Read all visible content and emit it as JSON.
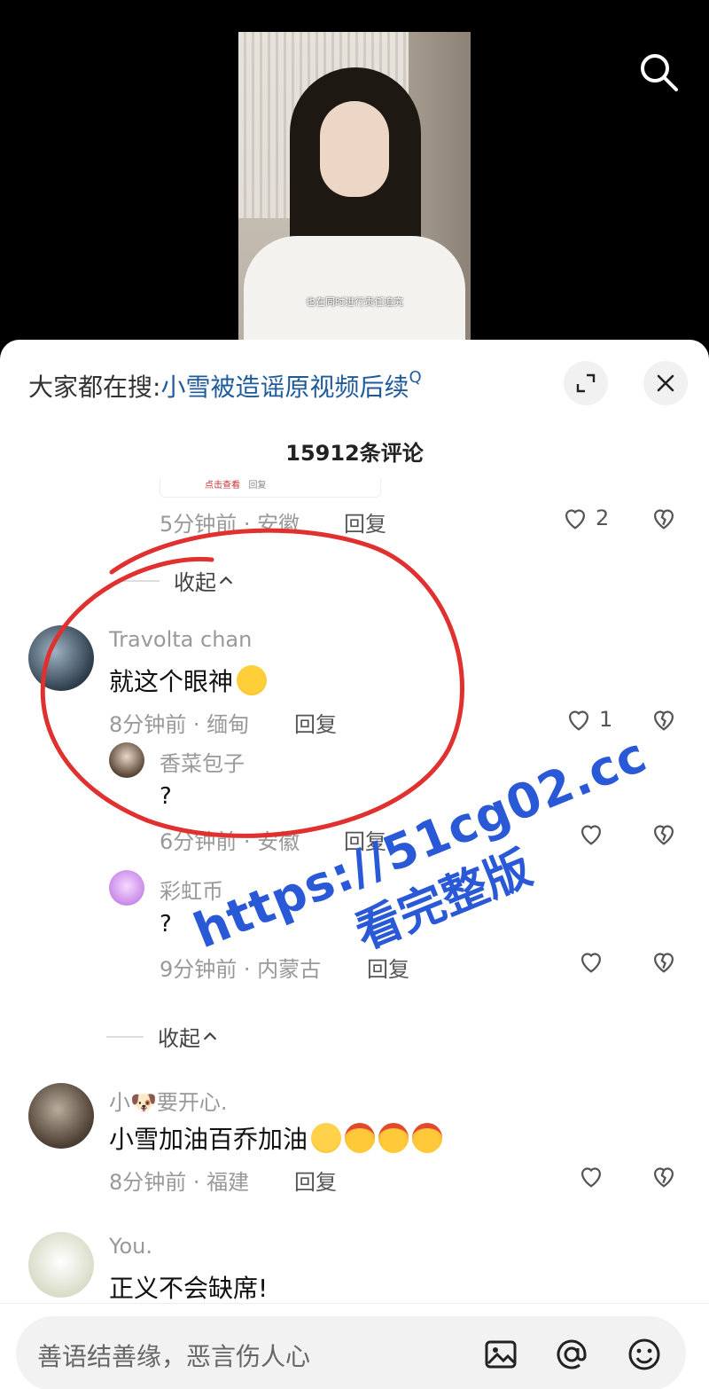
{
  "video": {
    "subtitle": "也在同时进行责任追究"
  },
  "trending": {
    "prefix": "大家都在搜:",
    "query": "小雪被造谣原视频后续",
    "search_mark": "Q"
  },
  "comments_header": {
    "count_label": "15912条评论"
  },
  "preview_card": {
    "left_text": "点击查看",
    "mid_text": "回复"
  },
  "thread0": {
    "meta": "5分钟前 · 安徽",
    "reply": "回复",
    "likes": "2"
  },
  "collapse_label": "收起",
  "comments": [
    {
      "user": "Travolta chan",
      "text": "就这个眼神",
      "meta": "8分钟前 · 缅甸",
      "reply": "回复",
      "likes": "1"
    },
    {
      "user": "香菜包子",
      "text": "?",
      "meta": "6分钟前 · 安徽",
      "reply": "回复"
    },
    {
      "user": "彩虹币",
      "text": "?",
      "meta": "9分钟前 · 内蒙古",
      "reply": "回复"
    },
    {
      "user": "小🐶要开心.",
      "text": "小雪加油百乔加油",
      "meta": "8分钟前 · 福建",
      "reply": "回复"
    },
    {
      "user": "You.",
      "text": "正义不会缺席!"
    }
  ],
  "watermark": {
    "line1": "https://51cg02.cc",
    "line2": "看完整版"
  },
  "input": {
    "placeholder": "善语结善缘，恶言伤人心"
  },
  "icons": [
    "search-icon",
    "expand-icon",
    "close-icon",
    "heart-icon",
    "heart-broken-icon",
    "image-icon",
    "at-icon",
    "emoji-icon"
  ],
  "colors": {
    "accent_link": "#1f5b9c",
    "watermark": "#2a59d8",
    "annotation": "#e0302f"
  }
}
